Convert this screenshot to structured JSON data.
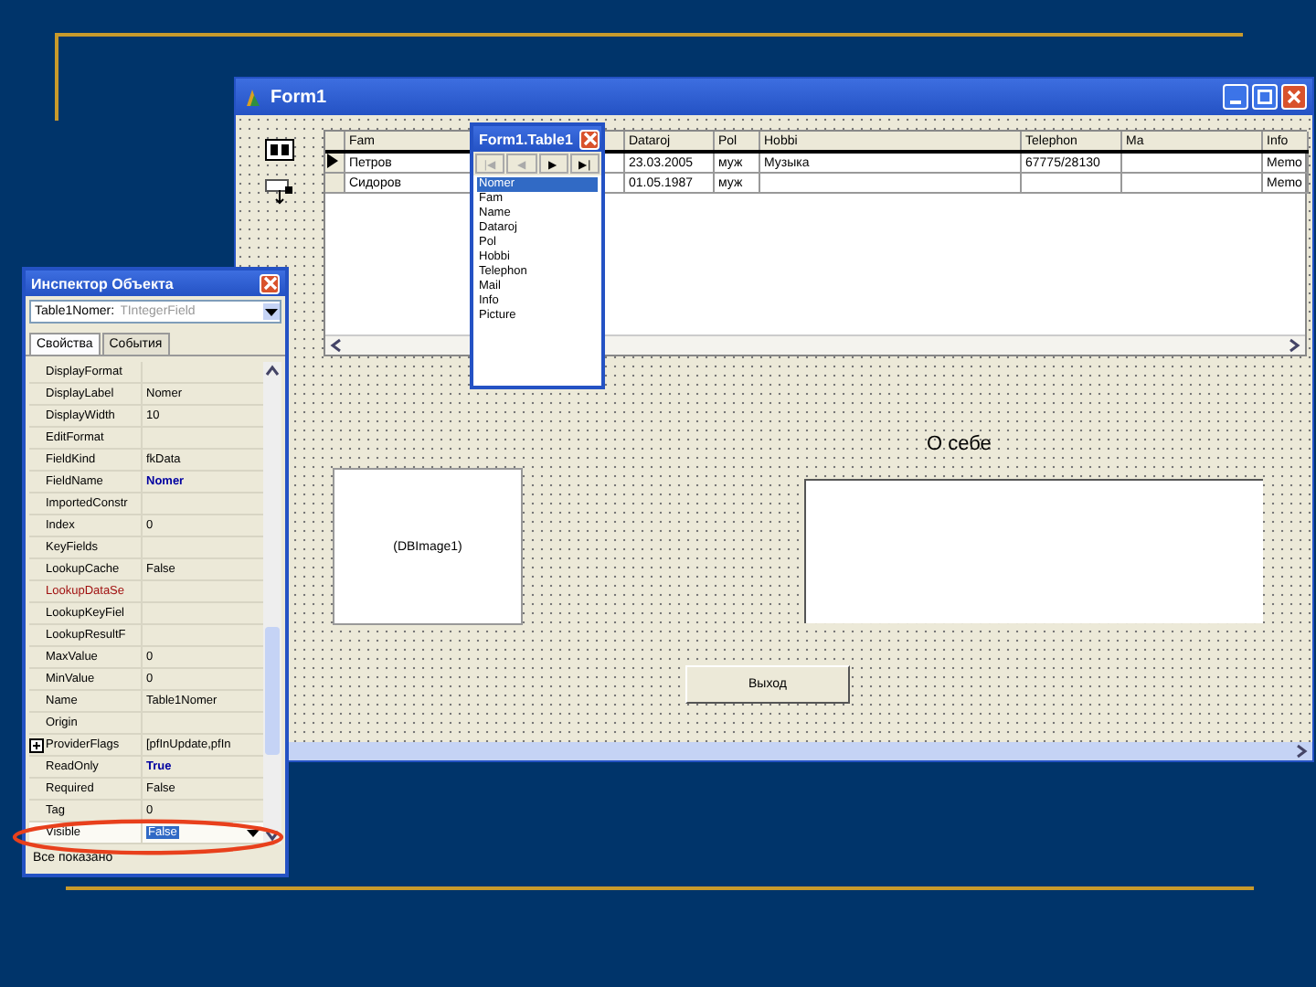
{
  "form": {
    "title": "Form1",
    "grid": {
      "columns": [
        "Fam",
        "Dataroj",
        "Pol",
        "Hobbi",
        "Telephon",
        "Ma",
        "Info"
      ],
      "rows": [
        {
          "selected": true,
          "cells": [
            "Петров",
            "23.03.2005",
            "муж",
            "Музыка",
            "67775/28130",
            "",
            "Memo"
          ]
        },
        {
          "selected": false,
          "cells": [
            "Сидоров",
            "01.05.1987",
            "муж",
            "",
            "",
            "",
            "Memo"
          ]
        }
      ]
    },
    "image_caption": "(DBImage1)",
    "memo_label": "О себе",
    "exit_button": "Выход"
  },
  "fields_editor": {
    "title": "Form1.Table1",
    "nav": [
      {
        "symbol": "|◀",
        "disabled": true
      },
      {
        "symbol": "◀",
        "disabled": true
      },
      {
        "symbol": "▶",
        "disabled": false
      },
      {
        "symbol": "▶|",
        "disabled": false
      }
    ],
    "fields": [
      {
        "label": "Nomer",
        "selected": true
      },
      {
        "label": "Fam",
        "selected": false
      },
      {
        "label": "Name",
        "selected": false
      },
      {
        "label": "Dataroj",
        "selected": false
      },
      {
        "label": "Pol",
        "selected": false
      },
      {
        "label": "Hobbi",
        "selected": false
      },
      {
        "label": "Telephon",
        "selected": false
      },
      {
        "label": "Mail",
        "selected": false
      },
      {
        "label": "Info",
        "selected": false
      },
      {
        "label": "Picture",
        "selected": false
      }
    ]
  },
  "inspector": {
    "title": "Инспектор Объекта",
    "object": "Table1Nomer:",
    "object_type": "TIntegerField",
    "tabs": [
      {
        "label": "Свойства",
        "selected": true
      },
      {
        "label": "События",
        "selected": false
      }
    ],
    "properties": [
      {
        "kind": "plain",
        "name": "DisplayFormat",
        "selected": false
      },
      {
        "kind": "plain",
        "name": "DisplayLabel",
        "value": "Nomer",
        "modified": false,
        "selected": false
      },
      {
        "kind": "plain",
        "name": "DisplayWidth",
        "value": "10",
        "modified": false,
        "selected": false
      },
      {
        "kind": "plain",
        "name": "EditFormat",
        "selected": false
      },
      {
        "kind": "plain",
        "name": "FieldKind",
        "value": "fkData",
        "modified": false,
        "selected": false
      },
      {
        "kind": "plain",
        "name": "FieldName",
        "value": "Nomer",
        "modified": true,
        "selected": false
      },
      {
        "kind": "plain",
        "name": "ImportedConstr",
        "selected": false
      },
      {
        "kind": "plain",
        "name": "Index",
        "value": "0",
        "modified": false,
        "selected": false
      },
      {
        "kind": "plain",
        "name": "KeyFields",
        "selected": false
      },
      {
        "kind": "plain",
        "name": "LookupCache",
        "value": "False",
        "modified": false,
        "selected": false
      },
      {
        "kind": "reference",
        "name": "LookupDataSe",
        "selected": false
      },
      {
        "kind": "plain",
        "name": "LookupKeyFiel",
        "selected": false
      },
      {
        "kind": "plain",
        "name": "LookupResultF",
        "selected": false
      },
      {
        "kind": "plain",
        "name": "MaxValue",
        "value": "0",
        "modified": false,
        "selected": false
      },
      {
        "kind": "plain",
        "name": "MinValue",
        "value": "0",
        "modified": false,
        "selected": false
      },
      {
        "kind": "plain",
        "name": "Name",
        "value": "Table1Nomer",
        "modified": false,
        "selected": false
      },
      {
        "kind": "plain",
        "name": "Origin",
        "selected": false
      },
      {
        "kind": "set",
        "name": "ProviderFlags",
        "value": "[pfInUpdate,pfIn",
        "modified": false,
        "selected": false
      },
      {
        "kind": "plain",
        "name": "ReadOnly",
        "value": "True",
        "modified": true,
        "selected": false
      },
      {
        "kind": "plain",
        "name": "Required",
        "value": "False",
        "modified": false,
        "selected": false
      },
      {
        "kind": "plain",
        "name": "Tag",
        "value": "0",
        "modified": false,
        "selected": false
      },
      {
        "kind": "plain",
        "name": "Visible",
        "value": "False",
        "modified": false,
        "selected": true
      }
    ],
    "status": "Все показано"
  }
}
